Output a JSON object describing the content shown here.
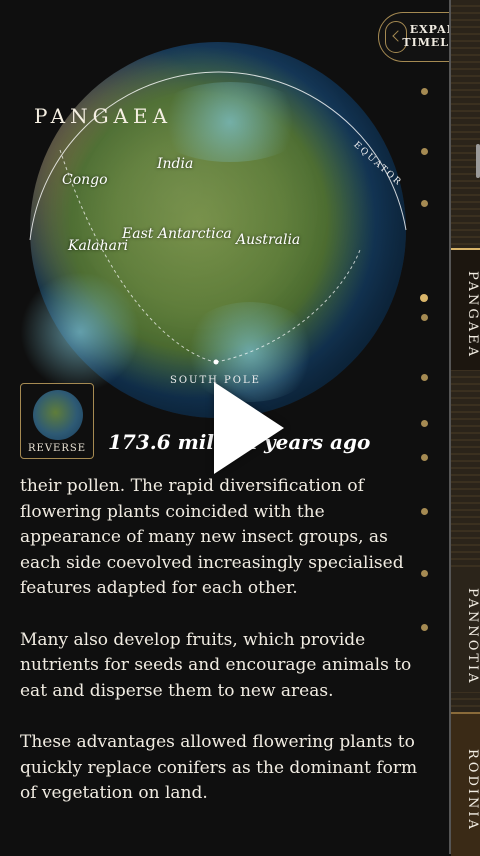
{
  "map": {
    "title": "PANGAEA",
    "equator": "EQUATOR",
    "south_pole": "SOUTH POLE",
    "regions": [
      "India",
      "Congo",
      "East Antarctica",
      "Kalahari",
      "Australia"
    ]
  },
  "header": {
    "expand_label": "EXPAND TIMELINE"
  },
  "controls": {
    "reverse_label": "REVERSE",
    "age_label": "173.6 million years ago"
  },
  "body": {
    "paragraphs": [
      "their pollen. The rapid diversification of flowering plants coincided with the appearance of many new insect groups, as each side coevolved increasingly specialised features adapted for each other.",
      "Many also develop fruits, which provide nutrients for seeds and encourage animals to eat and disperse them to new areas.",
      "These advantages allowed flowering plants to quickly replace conifers as the dominant form of vegetation on land."
    ]
  },
  "timeline": {
    "eras": [
      "PANGAEA",
      "PANNOTIA",
      "RODINIA"
    ]
  },
  "colors": {
    "accent": "#a58a52",
    "background": "#0f0f0f"
  }
}
